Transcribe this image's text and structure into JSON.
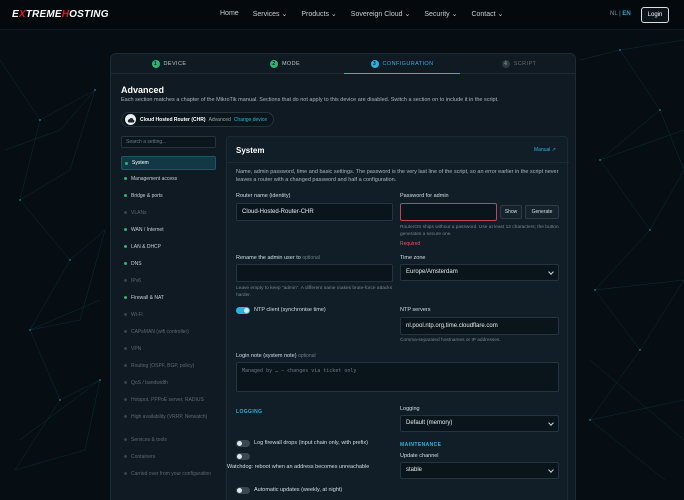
{
  "nav": {
    "logo_a": "E",
    "logo_x": "X",
    "logo_b": "TREME",
    "logo_c": "H",
    "logo_d": "OSTING",
    "items": [
      "Home",
      "Services ⌄",
      "Products ⌄",
      "Sovereign Cloud ⌄",
      "Security ⌄",
      "Contact ⌄"
    ],
    "lang_nl": "NL",
    "lang_sep": "|",
    "lang_en": "EN",
    "login": "Login"
  },
  "steps": [
    {
      "num": "1",
      "label": "DEVICE"
    },
    {
      "num": "2",
      "label": "MODE"
    },
    {
      "num": "3",
      "label": "CONFIGURATION"
    },
    {
      "num": "4",
      "label": "SCRIPT"
    }
  ],
  "advanced": {
    "title": "Advanced",
    "description": "Each section matches a chapter of the MikroTik manual. Sections that do not apply to this device are disabled. Switch a section on to include it in the script.",
    "device_name": "Cloud Hosted Router (CHR)",
    "device_mode": "Advanced",
    "change_device": "Change device"
  },
  "sidebar": {
    "search_placeholder": "Search a setting...",
    "items": [
      {
        "label": "System",
        "state": "selected"
      },
      {
        "label": "Management access",
        "state": "on"
      },
      {
        "label": "Bridge & ports",
        "state": "on"
      },
      {
        "label": "VLANs",
        "state": "disabled"
      },
      {
        "label": "WAN / Internet",
        "state": "on"
      },
      {
        "label": "LAN & DHCP",
        "state": "on"
      },
      {
        "label": "DNS",
        "state": "on"
      },
      {
        "label": "IPv6",
        "state": "disabled"
      },
      {
        "label": "Firewall & NAT",
        "state": "on"
      },
      {
        "label": "Wi-Fi",
        "state": "disabled"
      },
      {
        "label": "CAPsMAN (wifi controller)",
        "state": "disabled"
      },
      {
        "label": "VPN",
        "state": "disabled"
      },
      {
        "label": "Routing (OSPF, BGP, policy)",
        "state": "disabled"
      },
      {
        "label": "QoS / bandwidth",
        "state": "disabled"
      },
      {
        "label": "Hotspot, PPPoE server, RADIUS",
        "state": "disabled"
      },
      {
        "label": "High availability (VRRP, Netwatch)",
        "state": "disabled"
      },
      {
        "label": "Services & tools",
        "state": "disabled"
      },
      {
        "label": "Containers",
        "state": "disabled"
      },
      {
        "label": "Carried over from your configuration",
        "state": "disabled"
      }
    ]
  },
  "system": {
    "title": "System",
    "manual_link": "Manual ↗",
    "description": "Name, admin password, time and basic settings. The password is the very last line of the script, so an error earlier in the script never leaves a router with a changed password and half a configuration.",
    "router_name_label": "Router name (identity)",
    "router_name_value": "Cloud-Hosted-Router-CHR",
    "password_label": "Password for admin",
    "password_value": "",
    "show_button": "Show",
    "generate_button": "Generate",
    "password_hint": "RouterOS ships without a password. Use at least 12 characters; the button generates a secure one.",
    "password_required": "Required",
    "rename_label": "Rename the admin user to",
    "rename_optional": "optional",
    "rename_value": "",
    "rename_hint": "Leave empty to keep \"admin\". A different name makes brute-force attacks harder.",
    "timezone_label": "Time zone",
    "timezone_value": "Europe/Amsterdam",
    "ntp_toggle_label": "NTP client (synchronise time)",
    "ntp_toggle_on": true,
    "ntp_servers_label": "NTP servers",
    "ntp_servers_value": "nl.pool.ntp.org,time.cloudflare.com",
    "ntp_servers_hint": "Comma-separated hostnames or IP addresses.",
    "note_label": "Login note (system note)",
    "note_optional": "optional",
    "note_placeholder": "Managed by … — changes via ticket only",
    "logging_heading": "LOGGING",
    "logging_label": "Logging",
    "logging_value": "Default (memory)",
    "log_drops_label": "Log firewall drops (input chain only, with prefix)",
    "watchdog_label": "Watchdog: reboot when an address becomes unreachable",
    "maintenance_heading": "MAINTENANCE",
    "update_channel_label": "Update channel",
    "update_channel_value": "stable",
    "auto_updates_label": "Automatic updates (weekly, at night)"
  }
}
